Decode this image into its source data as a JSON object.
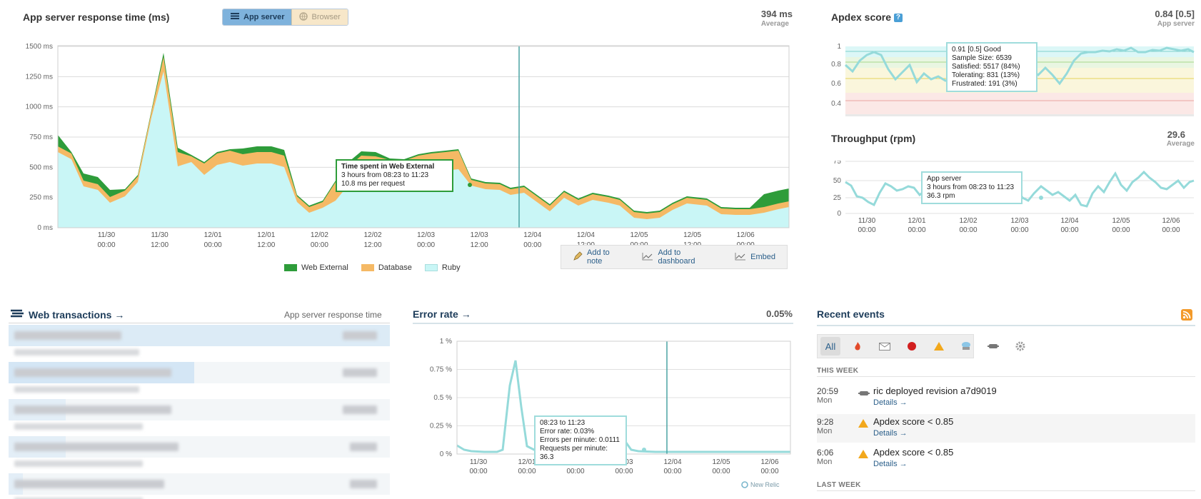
{
  "response_panel": {
    "title": "App server response time (ms)",
    "toggle": {
      "app_server": "App server",
      "browser": "Browser"
    },
    "avg_value": "394 ms",
    "avg_label": "Average",
    "y_ticks": [
      "1500 ms",
      "1250 ms",
      "1000 ms",
      "750 ms",
      "500 ms",
      "250 ms",
      "0 ms"
    ],
    "x_ticks": [
      [
        "11/30",
        "00:00"
      ],
      [
        "11/30",
        "12:00"
      ],
      [
        "12/01",
        "00:00"
      ],
      [
        "12/01",
        "12:00"
      ],
      [
        "12/02",
        "00:00"
      ],
      [
        "12/02",
        "12:00"
      ],
      [
        "12/03",
        "00:00"
      ],
      [
        "12/03",
        "12:00"
      ],
      [
        "12/04",
        "00:00"
      ],
      [
        "12/04",
        "12:00"
      ],
      [
        "12/05",
        "00:00"
      ],
      [
        "12/05",
        "12:00"
      ],
      [
        "12/06",
        "00:00"
      ]
    ],
    "legend": [
      {
        "label": "Web External",
        "color": "#2e9c3a"
      },
      {
        "label": "Database",
        "color": "#f5b965"
      },
      {
        "label": "Ruby",
        "color": "#c9f6f6"
      }
    ],
    "tooltip": {
      "title": "Time spent in Web External",
      "line1": "3 hours from 08:23 to 11:23",
      "line2": "10.8 ms per request"
    },
    "actions": {
      "note": "Add to note",
      "dashboard": "Add to dashboard",
      "embed": "Embed"
    }
  },
  "apdex_panel": {
    "title": "Apdex score",
    "help": "?",
    "value": "0.84 [0.5]",
    "sub": "App server",
    "y_ticks": [
      "1",
      "0.8",
      "0.6",
      "0.4"
    ],
    "tooltip": {
      "l1": "0.91 [0.5] Good",
      "l2": "Sample Size: 6539",
      "l3": "Satisfied: 5517 (84%)",
      "l4": "Tolerating: 831 (13%)",
      "l5": "Frustrated: 191 (3%)"
    }
  },
  "throughput_panel": {
    "title": "Throughput (rpm)",
    "value": "29.6",
    "sub": "Average",
    "y_ticks": [
      "75",
      "50",
      "25",
      "0"
    ],
    "x_ticks": [
      [
        "11/30",
        "00:00"
      ],
      [
        "12/01",
        "00:00"
      ],
      [
        "12/02",
        "00:00"
      ],
      [
        "12/03",
        "00:00"
      ],
      [
        "12/04",
        "00:00"
      ],
      [
        "12/05",
        "00:00"
      ],
      [
        "12/06",
        "00:00"
      ]
    ],
    "tooltip": {
      "l1": "App server",
      "l2": "3 hours from 08:23 to 11:23",
      "l3": "36.3 rpm"
    }
  },
  "web_tx": {
    "title": "Web transactions →",
    "col": "App server response time"
  },
  "error_panel": {
    "title": "Error rate →",
    "value": "0.05%",
    "y_ticks": [
      "1 %",
      "0.75 %",
      "0.5 %",
      "0.25 %",
      "0 %"
    ],
    "x_ticks": [
      [
        "11/30",
        "00:00"
      ],
      [
        "12/01",
        "00:00"
      ],
      [
        "12/02",
        "00:00"
      ],
      [
        "12/03",
        "00:00"
      ],
      [
        "12/04",
        "00:00"
      ],
      [
        "12/05",
        "00:00"
      ],
      [
        "12/06",
        "00:00"
      ]
    ],
    "tooltip": {
      "l1": "08:23 to 11:23",
      "l2": "Error rate: 0.03%",
      "l3": "Errors per minute: 0.0111",
      "l4": "Requests per minute: 36.3"
    },
    "brand": "New Relic"
  },
  "events": {
    "title": "Recent events",
    "filter_all": "All",
    "this_week": "THIS WEEK",
    "last_week": "LAST WEEK",
    "items": [
      {
        "time": "20:59",
        "day": "Mon",
        "text": "ric deployed revision a7d9019",
        "details": "Details →",
        "icon": "deploy-icon"
      },
      {
        "time": "9:28",
        "day": "Mon",
        "text": "Apdex score < 0.85",
        "details": "Details →",
        "icon": "warning-icon"
      },
      {
        "time": "6:06",
        "day": "Mon",
        "text": "Apdex score < 0.85",
        "details": "Details →",
        "icon": "warning-icon"
      }
    ]
  }
}
